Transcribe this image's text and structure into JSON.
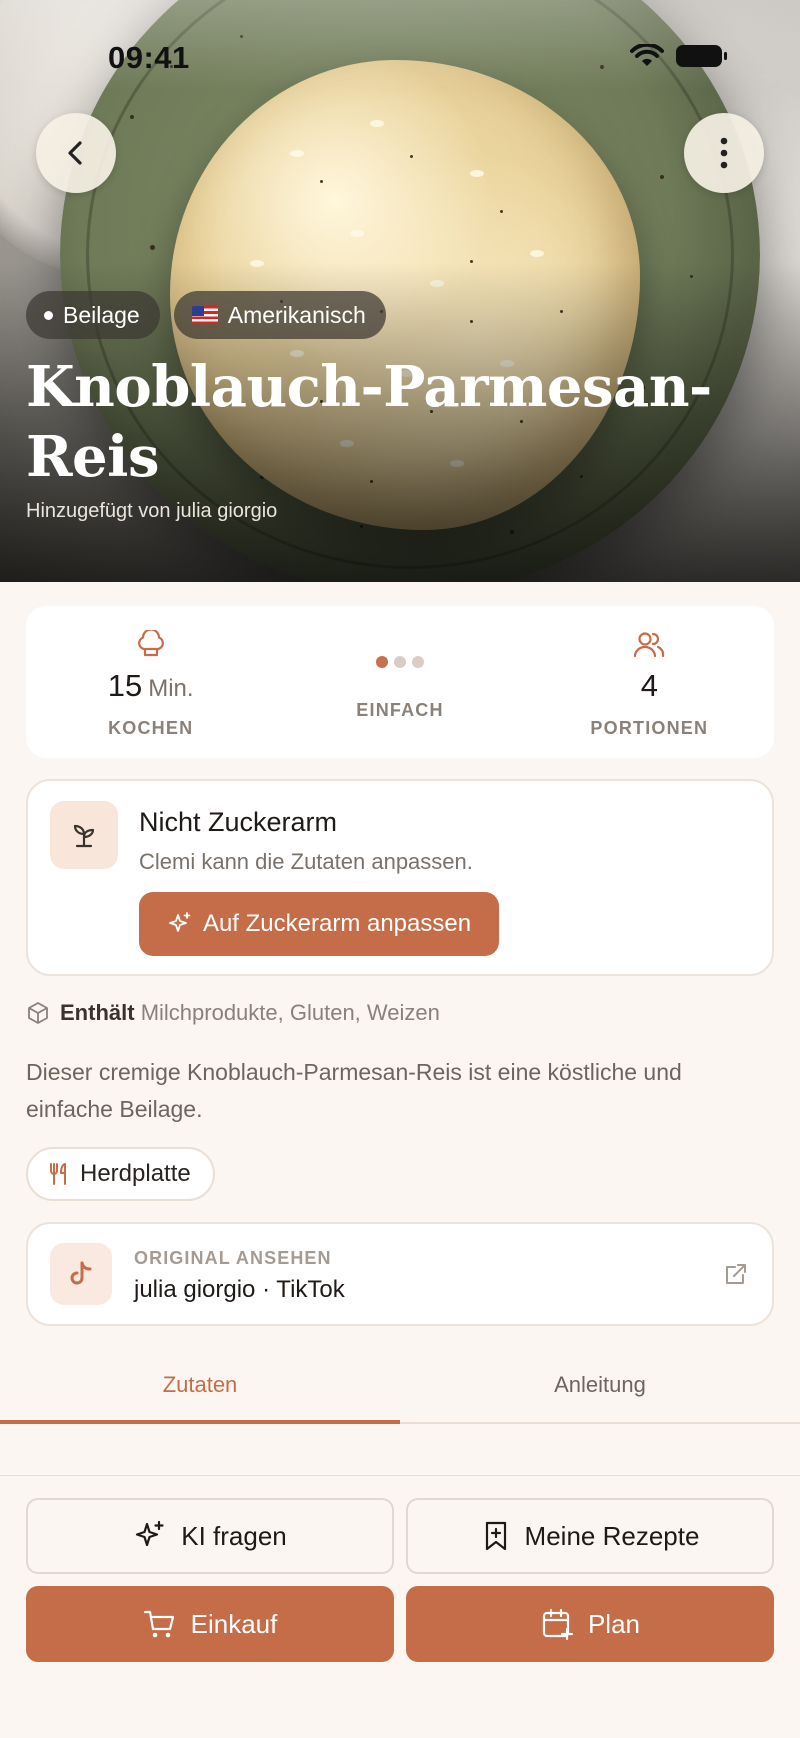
{
  "status_bar": {
    "time": "09:41"
  },
  "hero": {
    "chips": [
      {
        "label": "Beilage",
        "icon": "dot-icon"
      },
      {
        "label": "Amerikanisch",
        "icon": "us-flag-icon"
      }
    ],
    "title": "Knoblauch-Parmesan-Reis",
    "added_by": "Hinzugefügt von julia giorgio"
  },
  "stats": {
    "time": {
      "value": "15",
      "unit": "Min.",
      "label": "KOCHEN"
    },
    "difficulty": {
      "label": "EINFACH",
      "level": 1,
      "max": 3
    },
    "servings": {
      "value": "4",
      "label": "PORTIONEN"
    }
  },
  "sugar_card": {
    "title": "Nicht Zuckerarm",
    "subtitle": "Clemi kann die Zutaten anpassen.",
    "button": "Auf Zuckerarm anpassen"
  },
  "allergens": {
    "label": "Enthält",
    "values": "Milchprodukte, Gluten, Weizen"
  },
  "description": "Dieser cremige Knoblauch-Parmesan-Reis ist eine köstliche und einfache Beilage.",
  "equipment": {
    "label": "Herdplatte"
  },
  "original": {
    "kicker": "ORIGINAL ANSEHEN",
    "title": "julia giorgio · TikTok"
  },
  "tabs": [
    {
      "label": "Zutaten",
      "active": true
    },
    {
      "label": "Anleitung",
      "active": false
    }
  ],
  "actions": {
    "ask_ai": "KI fragen",
    "my_recipes": "Meine Rezepte",
    "shopping": "Einkauf",
    "plan": "Plan"
  },
  "colors": {
    "accent": "#c56d48",
    "background": "#fbf6f1",
    "card": "#ffffff"
  }
}
